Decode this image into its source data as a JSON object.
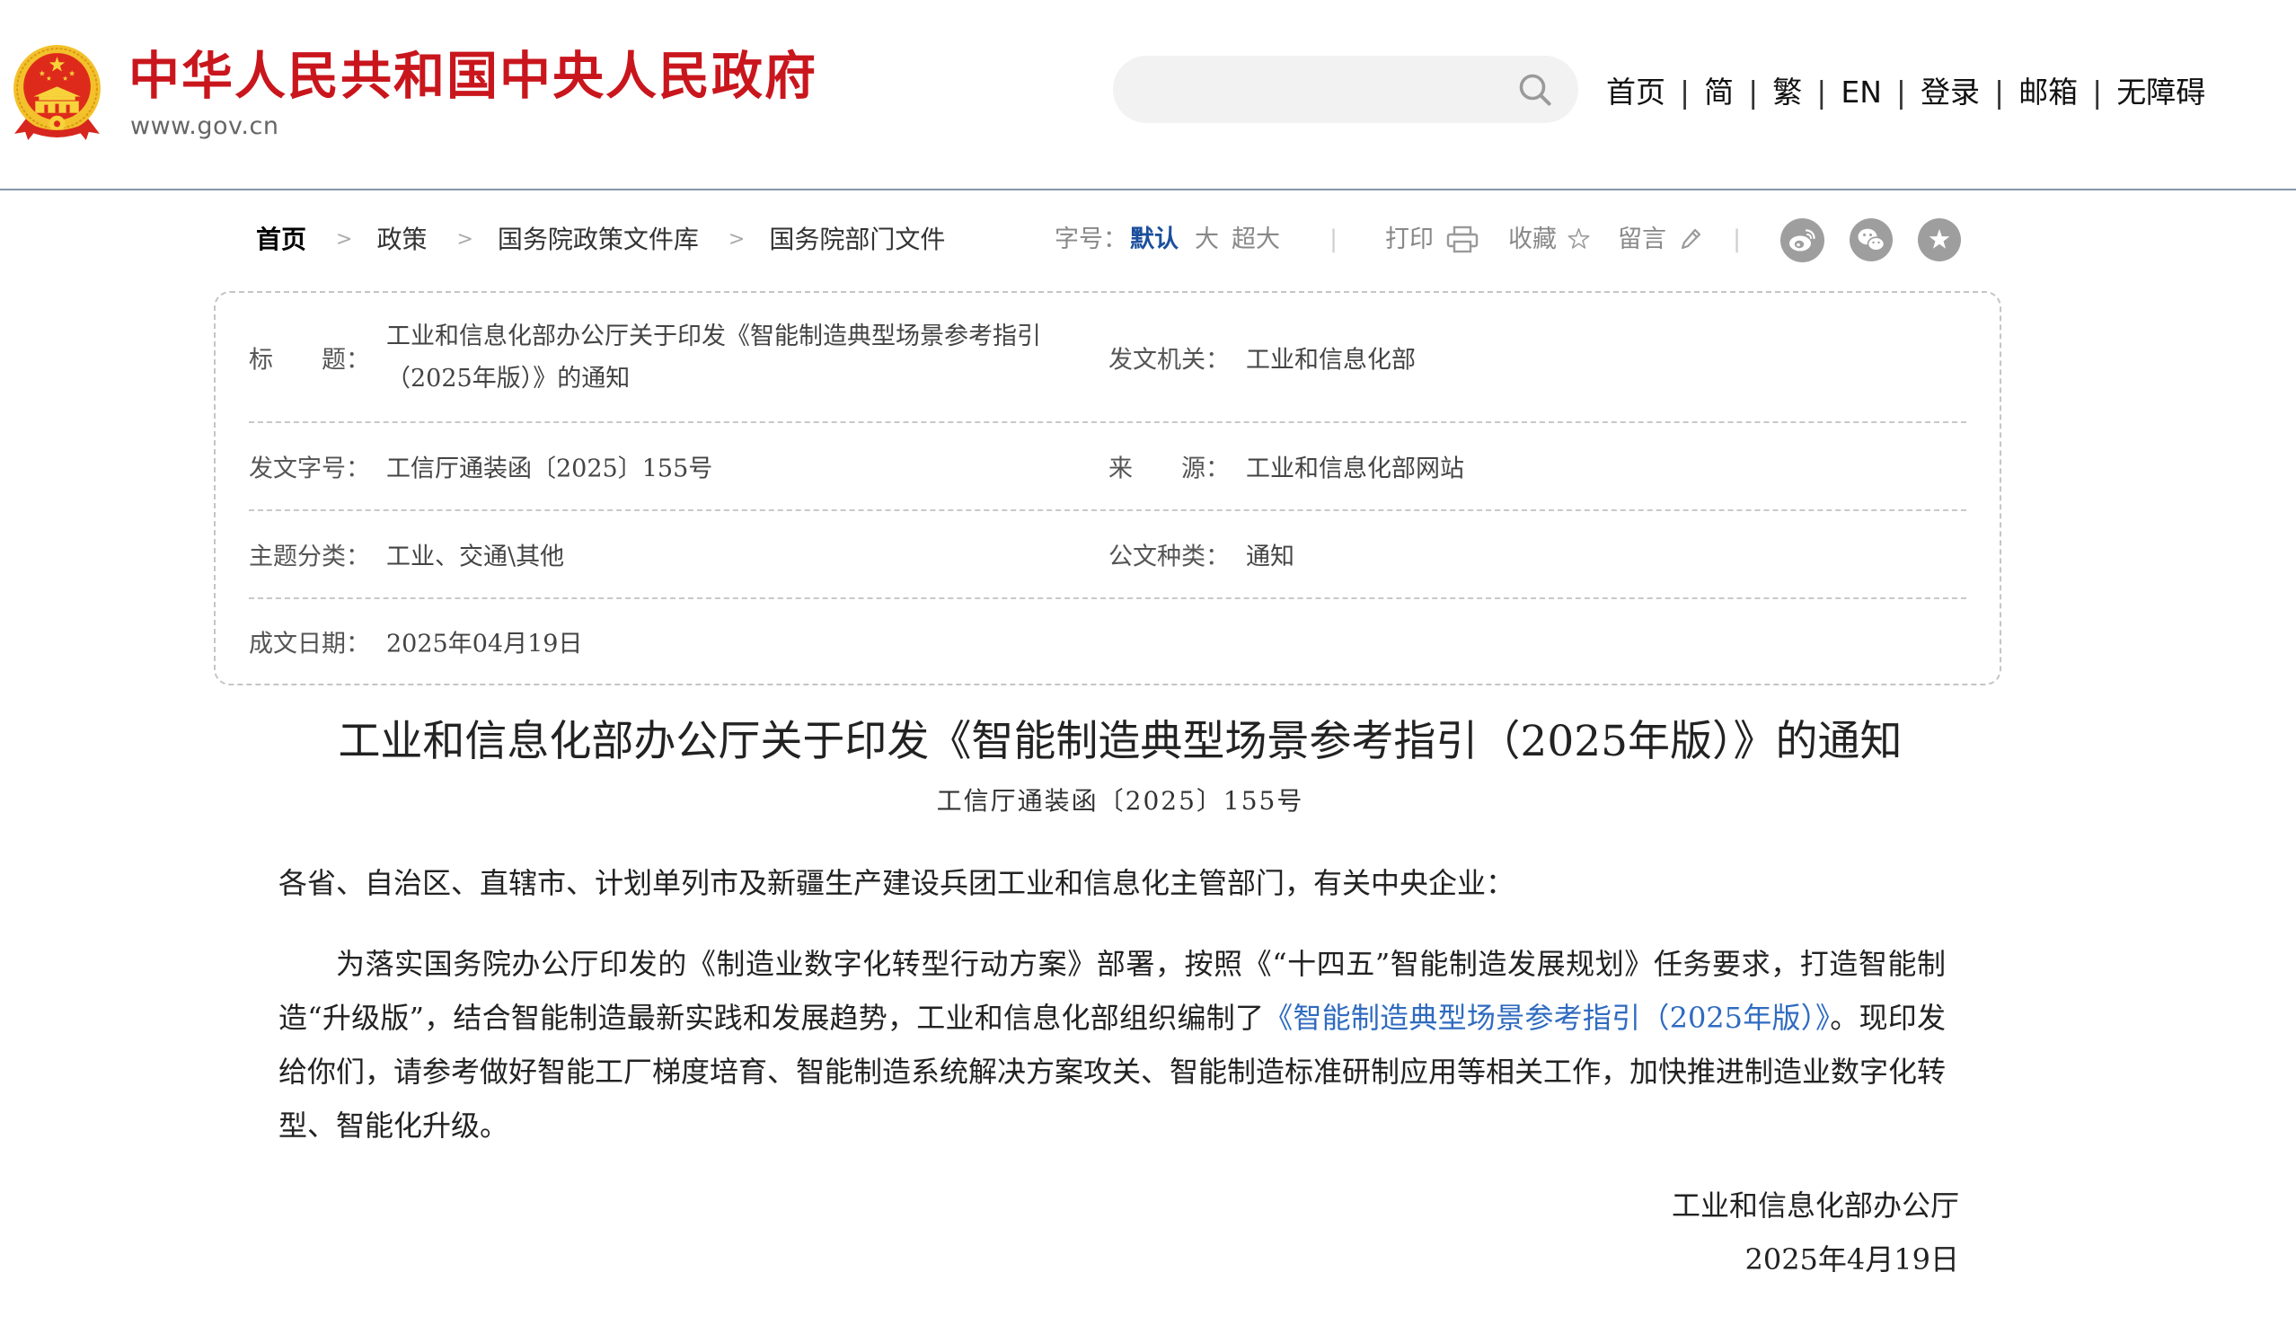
{
  "header": {
    "site_title": "中华人民共和国中央人民政府",
    "site_url": "www.gov.cn",
    "search": {
      "value": ""
    },
    "nav": [
      "首页",
      "简",
      "繁",
      "EN",
      "登录",
      "邮箱",
      "无障碍"
    ],
    "nav_separator": "|"
  },
  "breadcrumb": {
    "items": [
      "首页",
      "政策",
      "国务院政策文件库",
      "国务院部门文件"
    ],
    "separator": ">"
  },
  "toolbar": {
    "font_size_label": "字号：",
    "font_sizes": [
      {
        "label": "默认",
        "selected": true
      },
      {
        "label": "大",
        "selected": false
      },
      {
        "label": "超大",
        "selected": false
      }
    ],
    "separator": "|",
    "print_label": "打印",
    "favorite_label": "收藏",
    "comment_label": "留言"
  },
  "info": {
    "title": {
      "label": "标　　题：",
      "value": "工业和信息化部办公厅关于印发《智能制造典型场景参考指引（2025年版）》的通知"
    },
    "issuer": {
      "label": "发文机关：",
      "value": "工业和信息化部"
    },
    "doc_number": {
      "label": "发文字号：",
      "value": "工信厅通装函〔2025〕155号"
    },
    "source": {
      "label": "来　　源：",
      "value": "工业和信息化部网站"
    },
    "category": {
      "label": "主题分类：",
      "value": "工业、交通\\其他"
    },
    "doc_type": {
      "label": "公文种类：",
      "value": "通知"
    },
    "date": {
      "label": "成文日期：",
      "value": "2025年04月19日"
    }
  },
  "article": {
    "title": "工业和信息化部办公厅关于印发《智能制造典型场景参考指引（2025年版）》的通知",
    "doc_number": "工信厅通装函〔2025〕155号",
    "salutation": "各省、自治区、直辖市、计划单列市及新疆生产建设兵团工业和信息化主管部门，有关中央企业：",
    "body": {
      "before_link": "为落实国务院办公厅印发的《制造业数字化转型行动方案》部署，按照《“十四五”智能制造发展规划》任务要求，打造智能制造“升级版”，结合智能制造最新实践和发展趋势，工业和信息化部组织编制了",
      "link_text": "《智能制造典型场景参考指引（2025年版）》",
      "after_link": "。现印发给你们，请参考做好智能工厂梯度培育、智能制造系统解决方案攻关、智能制造标准研制应用等相关工作，加快推进制造业数字化转型、智能化升级。"
    },
    "signature": {
      "org": "工业和信息化部办公厅",
      "date": "2025年4月19日"
    }
  },
  "icons": {
    "emblem": "national-emblem-icon",
    "search": "search-icon",
    "print": "printer-icon",
    "favorite": "star-outline-icon",
    "comment": "pencil-icon",
    "share": [
      "weibo-icon",
      "wechat-icon",
      "star-circle-icon"
    ]
  },
  "colors": {
    "brand_red": "#c9161d",
    "link_blue": "#2f6bc0",
    "active_blue": "#1b4f9c",
    "header_rule": "#8596ab",
    "icon_gray": "#9e9e9e"
  }
}
